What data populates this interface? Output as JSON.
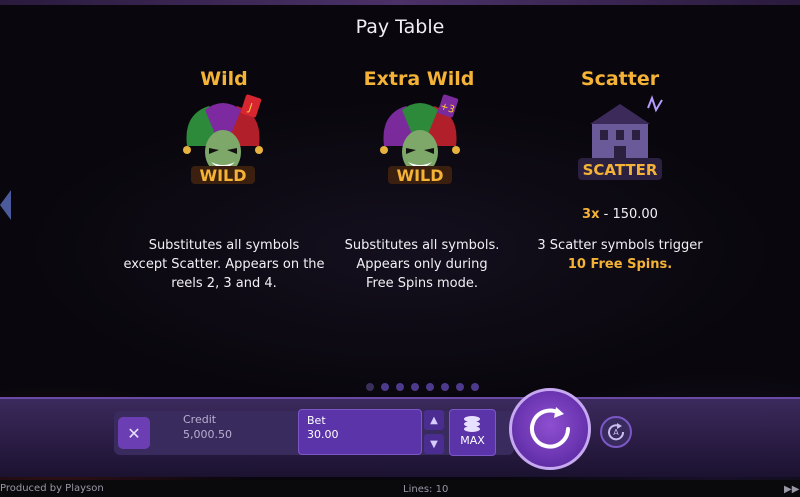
{
  "page_title": "Pay Table",
  "symbols": [
    {
      "title": "Wild",
      "badge": "WILD",
      "description_lines": [
        "Substitutes all symbols",
        "except Scatter. Appears on the",
        "reels 2, 3 and 4."
      ]
    },
    {
      "title": "Extra Wild",
      "badge": "WILD",
      "description_lines": [
        "Substitutes all symbols.",
        "Appears only during",
        "Free Spins mode."
      ]
    },
    {
      "title": "Scatter",
      "badge": "SCATTER",
      "payout": {
        "count": "3x",
        "separator": "-",
        "value": "150.00"
      },
      "description_lines": [
        "3 Scatter symbols trigger"
      ],
      "highlight": "10 Free Spins."
    }
  ],
  "pagination": {
    "total": 8,
    "active_index": 0
  },
  "controls": {
    "credit_label": "Credit",
    "credit_value": "5,000.50",
    "bet_label": "Bet",
    "bet_value": "30.00",
    "max_label": "MAX",
    "up_icon": "arrow-up-icon",
    "down_icon": "arrow-down-icon",
    "close_icon": "close-icon",
    "spin_icon": "spin-icon",
    "autoplay_icon": "autoplay-icon"
  },
  "footer": {
    "produced_by": "Produced by Playson",
    "lines": "Lines: 10",
    "fast_forward_icon": "fast-forward-icon"
  },
  "colors": {
    "accent": "#f4b336",
    "button": "#6b3fb3",
    "panel": "#3a2b5e"
  }
}
